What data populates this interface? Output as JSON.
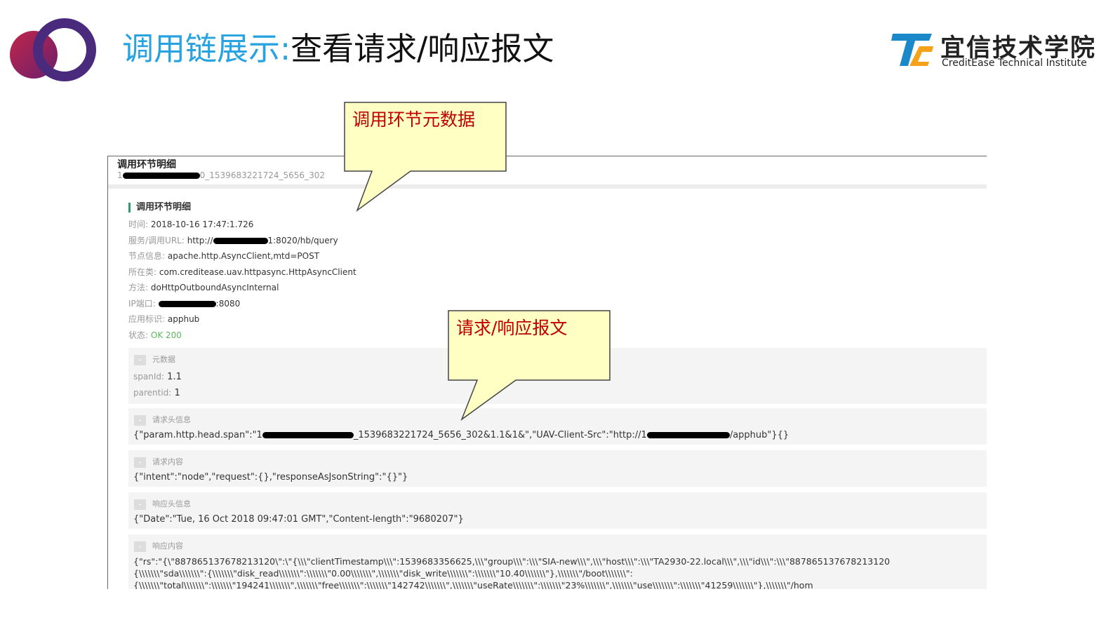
{
  "slide": {
    "title_blue": "调用链展示:",
    "title_dark": "查看请求/响应报文",
    "brand_cn": "宜信技术学院",
    "brand_en": "CreditEase Technical Institute",
    "colors": {
      "title_blue": "#29a3e0",
      "circle_purple": "#4a2a7d",
      "circle_red": "#b8254a",
      "brand_blue": "#1a88c9",
      "brand_orange": "#f5a21b",
      "callout_fill": "#ffffc3",
      "callout_text": "#c00000"
    }
  },
  "callouts": {
    "meta": "调用环节元数据",
    "payload": "请求/响应报文"
  },
  "shot": {
    "header_title": "调用环节明细",
    "trace_prefix": "1",
    "trace_suffix": "0_1539683221724_5656_302",
    "section_title": "调用环节明细",
    "fields": {
      "time_key": "时间:",
      "time_val": "2018-10-16 17:47:1.726",
      "url_key": "服务/调用URL:",
      "url_pre": "http://",
      "url_post": "1:8020/hb/query",
      "node_key": "节点信息:",
      "node_val": "apache.http.AsyncClient,mtd=POST",
      "class_key": "所在类:",
      "class_val": "com.creditease.uav.httpasync.HttpAsyncClient",
      "method_key": "方法:",
      "method_val": "doHttpOutboundAsyncInternal",
      "ip_key": "IP端口:",
      "ip_post": ":8080",
      "app_key": "应用标识:",
      "app_val": "apphub",
      "status_key": "状态:",
      "status_val": "OK 200"
    },
    "blocks": {
      "meta_title": "元数据",
      "span_key": "spanId:",
      "span_val": "1.1",
      "parent_key": "parentid:",
      "parent_val": "1",
      "req_head_title": "请求头信息",
      "req_head_pre": "{\"param.http.head.span\":\"1",
      "req_head_mid": "_1539683221724_5656_302&1.1&1&\",\"UAV-Client-Src\":\"http://1",
      "req_head_post": "/apphub\"}{}",
      "req_body_title": "请求内容",
      "req_body": "{\"intent\":\"node\",\"request\":{},\"responseAsJsonString\":\"{}\"}",
      "resp_head_title": "响应头信息",
      "resp_head": "{\"Date\":\"Tue, 16 Oct 2018 09:47:01 GMT\",\"Content-length\":\"9680207\"}",
      "resp_body_title": "响应内容",
      "resp_body_1": "{\"rs\":\"{\\\"887865137678213120\\\":\\\"{\\\\\\\"clientTimestamp\\\\\\\":1539683356625,\\\\\\\"group\\\\\\\":\\\\\\\"SIA-new\\\\\\\",\\\\\\\"host\\\\\\\":\\\\\\\"TA2930-22.local\\\\\\\",\\\\\\\"id\\\\\\\":\\\\\\\"887865137678213120",
      "resp_body_2": "{\\\\\\\\\\\\\\\"sda\\\\\\\\\\\\\\\":{\\\\\\\\\\\\\\\"disk_read\\\\\\\\\\\\\\\":\\\\\\\\\\\\\\\"0.00\\\\\\\\\\\\\\\",\\\\\\\\\\\\\\\"disk_write\\\\\\\\\\\\\\\":\\\\\\\\\\\\\\\"10.40\\\\\\\\\\\\\\\"},\\\\\\\\\\\\\\\"/boot\\\\\\\\\\\\\\\":",
      "resp_body_3": "{\\\\\\\\\\\\\\\"total\\\\\\\\\\\\\\\":\\\\\\\\\\\\\\\"194241\\\\\\\\\\\\\\\",\\\\\\\\\\\\\\\"free\\\\\\\\\\\\\\\":\\\\\\\\\\\\\\\"142742\\\\\\\\\\\\\\\",\\\\\\\\\\\\\\\"useRate\\\\\\\\\\\\\\\":\\\\\\\\\\\\\\\"23%\\\\\\\\\\\\\\\",\\\\\\\\\\\\\\\"use\\\\\\\\\\\\\\\":\\\\\\\\\\\\\\\"41259\\\\\\\\\\\\\\\"},\\\\\\\\\\\\\\\"/hom",
      "toggle": "-"
    }
  }
}
